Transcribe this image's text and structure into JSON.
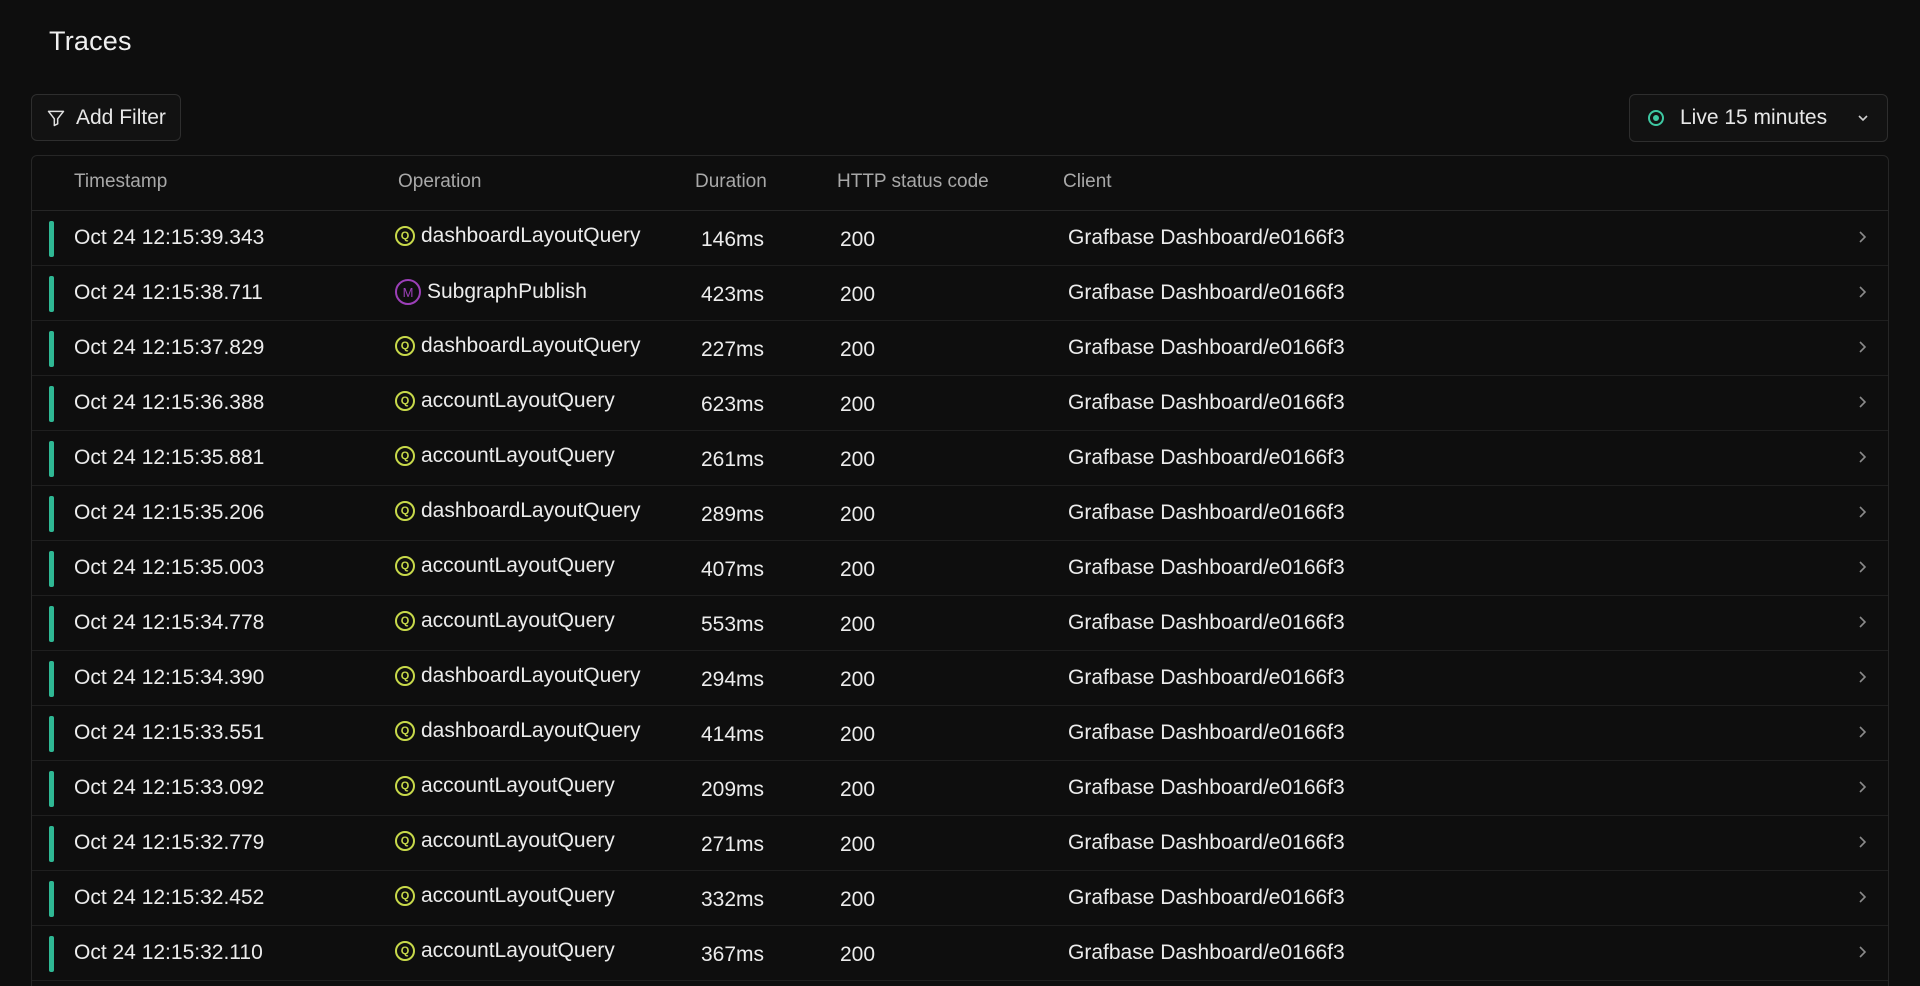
{
  "page": {
    "title": "Traces"
  },
  "toolbar": {
    "add_filter_label": "Add Filter",
    "live_label": "Live 15 minutes"
  },
  "table": {
    "columns": [
      "Timestamp",
      "Operation",
      "Duration",
      "HTTP status code",
      "Client"
    ],
    "rows": [
      {
        "timestamp": "Oct 24 12:15:39.343",
        "op_type": "Q",
        "operation": "dashboardLayoutQuery",
        "duration": "146ms",
        "status": "200",
        "client": "Grafbase Dashboard/e0166f3"
      },
      {
        "timestamp": "Oct 24 12:15:38.711",
        "op_type": "M",
        "operation": "SubgraphPublish",
        "duration": "423ms",
        "status": "200",
        "client": "Grafbase Dashboard/e0166f3"
      },
      {
        "timestamp": "Oct 24 12:15:37.829",
        "op_type": "Q",
        "operation": "dashboardLayoutQuery",
        "duration": "227ms",
        "status": "200",
        "client": "Grafbase Dashboard/e0166f3"
      },
      {
        "timestamp": "Oct 24 12:15:36.388",
        "op_type": "Q",
        "operation": "accountLayoutQuery",
        "duration": "623ms",
        "status": "200",
        "client": "Grafbase Dashboard/e0166f3"
      },
      {
        "timestamp": "Oct 24 12:15:35.881",
        "op_type": "Q",
        "operation": "accountLayoutQuery",
        "duration": "261ms",
        "status": "200",
        "client": "Grafbase Dashboard/e0166f3"
      },
      {
        "timestamp": "Oct 24 12:15:35.206",
        "op_type": "Q",
        "operation": "dashboardLayoutQuery",
        "duration": "289ms",
        "status": "200",
        "client": "Grafbase Dashboard/e0166f3"
      },
      {
        "timestamp": "Oct 24 12:15:35.003",
        "op_type": "Q",
        "operation": "accountLayoutQuery",
        "duration": "407ms",
        "status": "200",
        "client": "Grafbase Dashboard/e0166f3"
      },
      {
        "timestamp": "Oct 24 12:15:34.778",
        "op_type": "Q",
        "operation": "accountLayoutQuery",
        "duration": "553ms",
        "status": "200",
        "client": "Grafbase Dashboard/e0166f3"
      },
      {
        "timestamp": "Oct 24 12:15:34.390",
        "op_type": "Q",
        "operation": "dashboardLayoutQuery",
        "duration": "294ms",
        "status": "200",
        "client": "Grafbase Dashboard/e0166f3"
      },
      {
        "timestamp": "Oct 24 12:15:33.551",
        "op_type": "Q",
        "operation": "dashboardLayoutQuery",
        "duration": "414ms",
        "status": "200",
        "client": "Grafbase Dashboard/e0166f3"
      },
      {
        "timestamp": "Oct 24 12:15:33.092",
        "op_type": "Q",
        "operation": "accountLayoutQuery",
        "duration": "209ms",
        "status": "200",
        "client": "Grafbase Dashboard/e0166f3"
      },
      {
        "timestamp": "Oct 24 12:15:32.779",
        "op_type": "Q",
        "operation": "accountLayoutQuery",
        "duration": "271ms",
        "status": "200",
        "client": "Grafbase Dashboard/e0166f3"
      },
      {
        "timestamp": "Oct 24 12:15:32.452",
        "op_type": "Q",
        "operation": "accountLayoutQuery",
        "duration": "332ms",
        "status": "200",
        "client": "Grafbase Dashboard/e0166f3"
      },
      {
        "timestamp": "Oct 24 12:15:32.110",
        "op_type": "Q",
        "operation": "accountLayoutQuery",
        "duration": "367ms",
        "status": "200",
        "client": "Grafbase Dashboard/e0166f3"
      }
    ]
  },
  "colors": {
    "background": "#0e0e0e",
    "status_bar": "#2fb894",
    "query_badge": "#c8d94a",
    "mutation_badge": "#9c3fb8",
    "live_dot": "#3ec8a2"
  },
  "icons": {
    "filter": "filter-icon",
    "live": "live-indicator-icon",
    "dropdown": "chevron-down-icon",
    "row_arrow": "chevron-right-icon"
  }
}
